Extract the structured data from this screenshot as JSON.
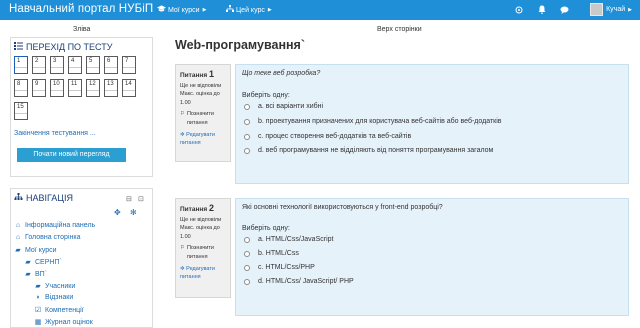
{
  "navbar": {
    "brand": "Навчальний портал НУБіП",
    "my_courses": "Мої курси",
    "this_course": "Цей курс",
    "user": "Кучай",
    "bg_color": "#1f8fd8"
  },
  "regions": {
    "left": "Зліва",
    "top": "Верх сторінки"
  },
  "quiz_nav": {
    "title": "ПЕРЕХІД ПО ТЕСТУ",
    "buttons": [
      "1",
      "2",
      "3",
      "4",
      "5",
      "6",
      "7",
      "8",
      "9",
      "10",
      "11",
      "12",
      "13",
      "14",
      "15"
    ],
    "finish": "Закінчення тестування ...",
    "restart": "Почати новий перегляд"
  },
  "navigation": {
    "title": "НАВІГАЦІЯ",
    "items": [
      {
        "label": "Інформаційна панель",
        "icon": "home-icon"
      },
      {
        "label": "Головна сторінка",
        "icon": "home-icon"
      },
      {
        "label": "Мої курси",
        "icon": "folder-icon"
      },
      {
        "label": "СЕРНП`",
        "icon": "graduation-cap-icon"
      },
      {
        "label": "ВП`",
        "icon": "folder-icon"
      },
      {
        "label": "Учасники",
        "icon": "users-icon"
      },
      {
        "label": "Відзнаки",
        "icon": "shield-icon"
      },
      {
        "label": "Компетенції",
        "icon": "checkbox-icon"
      },
      {
        "label": "Журнал оцінок",
        "icon": "table-icon"
      }
    ]
  },
  "page": {
    "title": "Web-програмування`"
  },
  "questions": [
    {
      "label": "Питання",
      "number": "1",
      "status": "Ще не відповіли",
      "max_grade": "Макс. оцінка до 1.00",
      "flag": "Позначити питання",
      "edit": "Редагувати питання",
      "text": "Що теке веб розробка?",
      "prompt": "Виберіть одну:",
      "answers": [
        "a. всі варіанти хибні",
        "b. проектування призначених для користувача веб-сайтів або веб-додатків",
        "c. процес створення веб-додатків та веб-сайтів",
        "d. веб програмування не відділяють від поняття програмування загалом"
      ]
    },
    {
      "label": "Питання",
      "number": "2",
      "status": "Ще не відповіли",
      "max_grade": "Макс. оцінка до 1.00",
      "flag": "Позначити питання",
      "edit": "Редагувати питання",
      "text": "Які основні технології використовуються у front-end розробці?",
      "prompt": "Виберіть одну:",
      "answers": [
        "a. HTML/Css/JavaScript",
        "b. HTML/Css",
        "c. HTML/Css/PHP",
        "d. HTML/Css/ JavaScript/ PHP"
      ]
    }
  ]
}
